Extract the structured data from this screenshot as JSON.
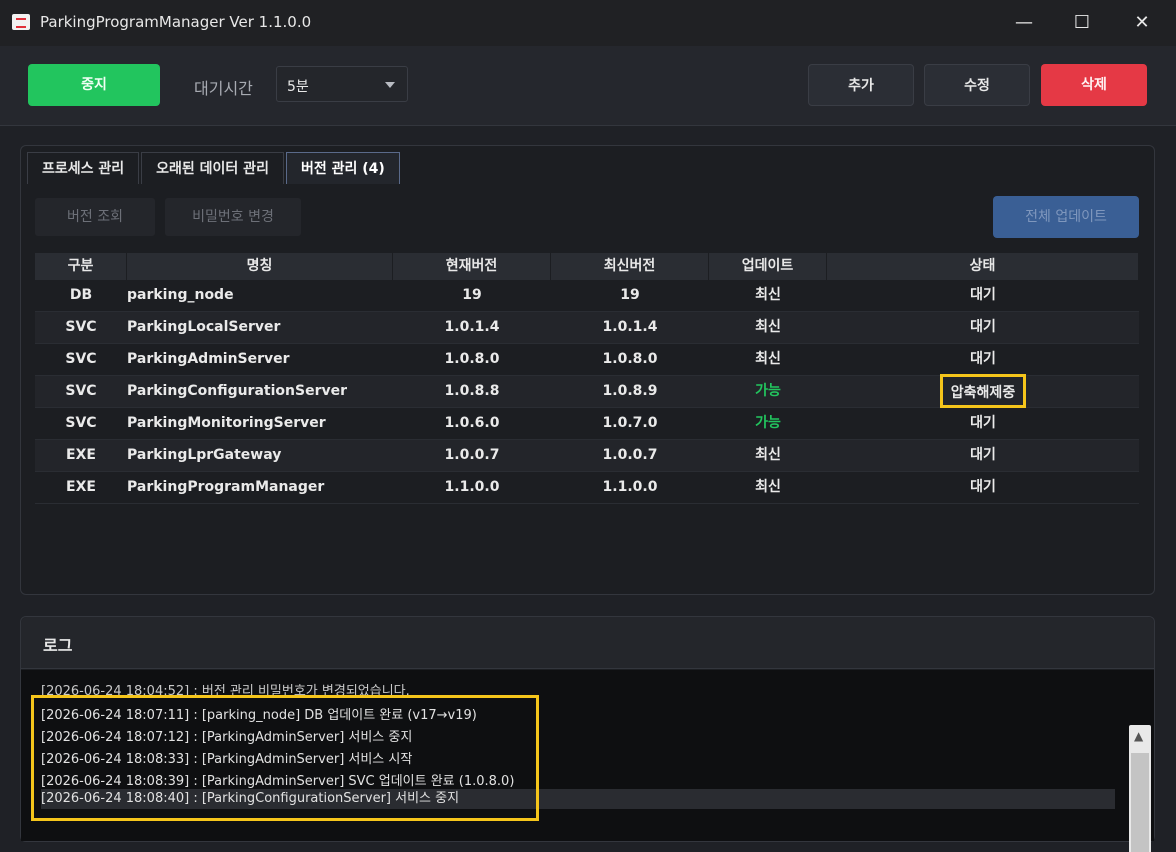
{
  "window": {
    "title": "ParkingProgramManager Ver 1.1.0.0",
    "minimize": "—",
    "maximize": "☐",
    "close": "✕"
  },
  "toolbar": {
    "stop_label": "중지",
    "wait_label": "대기시간",
    "wait_value": "5분",
    "add_label": "추가",
    "edit_label": "수정",
    "delete_label": "삭제"
  },
  "tabs": [
    {
      "label": "프로세스 관리",
      "active": false
    },
    {
      "label": "오래된 데이터 관리",
      "active": false
    },
    {
      "label": "버전 관리 (4)",
      "active": true
    }
  ],
  "version": {
    "view_btn": "버전 조회",
    "password_btn": "비밀번호 변경",
    "update_all_btn": "전체 업데이트",
    "columns": [
      "구분",
      "명칭",
      "현재버전",
      "최신버전",
      "업데이트",
      "상태"
    ],
    "rows": [
      {
        "type": "DB",
        "name": "parking_node",
        "current": "19",
        "latest": "19",
        "update": "최신",
        "status": "대기"
      },
      {
        "type": "SVC",
        "name": "ParkingLocalServer",
        "current": "1.0.1.4",
        "latest": "1.0.1.4",
        "update": "최신",
        "status": "대기"
      },
      {
        "type": "SVC",
        "name": "ParkingAdminServer",
        "current": "1.0.8.0",
        "latest": "1.0.8.0",
        "update": "최신",
        "status": "대기"
      },
      {
        "type": "SVC",
        "name": "ParkingConfigurationServer",
        "current": "1.0.8.8",
        "latest": "1.0.8.9",
        "update": "가능",
        "status": "압축해제중"
      },
      {
        "type": "SVC",
        "name": "ParkingMonitoringServer",
        "current": "1.0.6.0",
        "latest": "1.0.7.0",
        "update": "가능",
        "status": "대기"
      },
      {
        "type": "EXE",
        "name": "ParkingLprGateway",
        "current": "1.0.0.7",
        "latest": "1.0.0.7",
        "update": "최신",
        "status": "대기"
      },
      {
        "type": "EXE",
        "name": "ParkingProgramManager",
        "current": "1.1.0.0",
        "latest": "1.1.0.0",
        "update": "최신",
        "status": "대기"
      }
    ]
  },
  "log": {
    "title": "로그",
    "lines": [
      "[2026-06-24 18:04:52] : 버전 관리 비밀번호가 변경되었습니다.",
      "[2026-06-24 18:07:11] : [parking_node] DB 업데이트 완료 (v17→v19)",
      "[2026-06-24 18:07:12] : [ParkingAdminServer] 서비스 중지",
      "[2026-06-24 18:08:33] : [ParkingAdminServer] 서비스 시작",
      "[2026-06-24 18:08:39] : [ParkingAdminServer] SVC 업데이트 완료 (1.0.8.0)",
      "[2026-06-24 18:08:40] : [ParkingConfigurationServer] 서비스 중지"
    ]
  },
  "colors": {
    "stop": "#22c55e",
    "delete": "#e53945",
    "update_all": "#3a5f95",
    "available": "#22c55e",
    "highlight": "#f5c51b"
  }
}
